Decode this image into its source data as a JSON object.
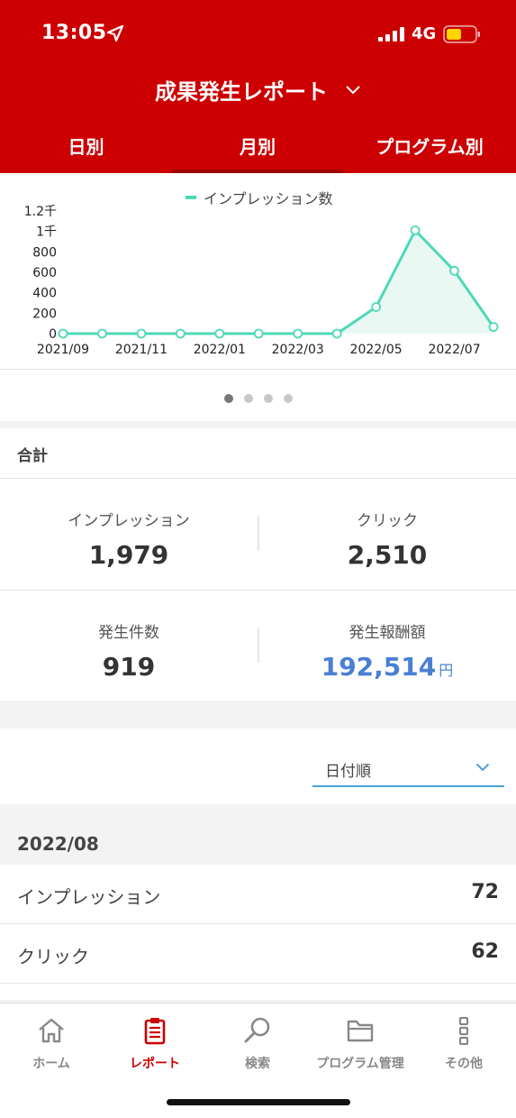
{
  "status_bar": {
    "time": "13:05",
    "network": "4G"
  },
  "header": {
    "title": "成果発生レポート"
  },
  "tabs": [
    {
      "label": "日別",
      "active": false
    },
    {
      "label": "月別",
      "active": true
    },
    {
      "label": "プログラム別",
      "active": false
    }
  ],
  "chart_data": {
    "type": "area",
    "legend": "インプレッション数",
    "x": [
      "2021/09",
      "2021/10",
      "2021/11",
      "2021/12",
      "2022/01",
      "2022/02",
      "2022/03",
      "2022/04",
      "2022/05",
      "2022/06",
      "2022/07",
      "2022/08"
    ],
    "x_tick_labels": [
      "2021/09",
      "2021/11",
      "2022/01",
      "2022/03",
      "2022/05",
      "2022/07"
    ],
    "values": [
      0,
      0,
      0,
      0,
      0,
      0,
      0,
      0,
      260,
      1010,
      615,
      65
    ],
    "y_tick_labels": [
      "0",
      "200",
      "400",
      "600",
      "800",
      "1千",
      "1.2千"
    ],
    "ylim": [
      0,
      1200
    ],
    "color": "#4dd9b8",
    "fill": "#eaf8f4",
    "pager": {
      "pages": 4,
      "active": 0
    }
  },
  "totals": {
    "title": "合計",
    "metrics": [
      {
        "label": "インプレッション",
        "value": "1,979"
      },
      {
        "label": "クリック",
        "value": "2,510"
      },
      {
        "label": "発生件数",
        "value": "919"
      },
      {
        "label": "発生報酬額",
        "value": "192,514",
        "unit": "円",
        "accent": "#4a7fd4"
      }
    ]
  },
  "sort": {
    "selected": "日付順",
    "underline_color": "#4aa3d8"
  },
  "month_section": {
    "month": "2022/08",
    "rows": [
      {
        "label": "インプレッション",
        "value": "72"
      },
      {
        "label": "クリック",
        "value": "62"
      }
    ]
  },
  "bottom_nav": [
    {
      "label": "ホーム",
      "icon": "home-icon",
      "active": false
    },
    {
      "label": "レポート",
      "icon": "clipboard-icon",
      "active": true
    },
    {
      "label": "検索",
      "icon": "search-icon",
      "active": false
    },
    {
      "label": "プログラム管理",
      "icon": "folder-icon",
      "active": false
    },
    {
      "label": "その他",
      "icon": "more-vertical-icon",
      "active": false
    }
  ],
  "colors": {
    "brand_red": "#cc0000",
    "active_tab_indicator": "#a00000"
  }
}
